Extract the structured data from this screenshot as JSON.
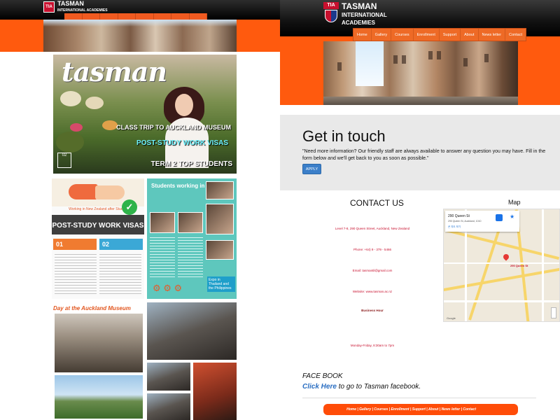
{
  "left_page": {
    "logo_tia": "TIA",
    "logo_text": "TASMAN",
    "logo_sub": "INTERNATIONAL ACADEMIES",
    "cover": {
      "masthead": "tasman",
      "headline1": "CLASS TRIP TO AUCKLAND MUSEUM",
      "headline2": "POST-STUDY WORK VISAS",
      "headline3": "TERM 2 TOP STUDENTS",
      "issue": "02"
    },
    "visa_page": {
      "subtitle": "Working in New Zealand after Studies",
      "title": "POST-STUDY WORK VISAS",
      "box1_num": "01",
      "box2_num": "02"
    },
    "industry_page": {
      "title": "Students working in industry",
      "caption": "Expo in Thailand and the Philippines"
    },
    "museum_page": {
      "title": "Day at the Auckland Museum"
    }
  },
  "site": {
    "brand_line1": "TASMAN",
    "brand_line2": "INTERNATIONAL",
    "brand_line3": "ACADEMIES",
    "logo_tia": "TIA",
    "nav": [
      "Home",
      "Gallery",
      "Courses",
      "Enrollment",
      "Support",
      "About",
      "News letter",
      "Contact"
    ],
    "get_in_touch": {
      "title": "Get in touch",
      "body": "\"Need more information? Our friendly staff are always available to answer any question you may have. Fill in the form below and we'll get back to you as soon as possible.\"",
      "button": "APPLY"
    },
    "contact": {
      "title": "CONTACT US",
      "address": "Level 7-8, 290 Queen Street, Auckland, New Zealand",
      "phone": "Phone: +64) 9 - 379 - 5466",
      "email": "Email: tasmantil@gmail.com",
      "website": "Website: www.tasman.ac.nz",
      "hours_title": "Business Hour",
      "hours": "Monday-Friday, 8:30am to 7pm"
    },
    "map": {
      "title": "Map",
      "card_title": "290 Queen St",
      "card_sub": "290 Queen St, Auckland, 1010",
      "card_link": "큰 지도 보기",
      "pin_label": "290 Queen St",
      "attribution": "Google"
    },
    "facebook": {
      "title": "FACE BOOK",
      "link_text": "Click Here",
      "link_suffix": " to go to Tasman facebook."
    },
    "footer": "Home | Gallery | Courses | Enrollment | Support | About | News letter | Contact"
  },
  "colors": {
    "orange": "#ff5a0e",
    "header_black": "#000000",
    "apply_blue": "#3b7fc9",
    "crest_red": "#c8102e"
  }
}
